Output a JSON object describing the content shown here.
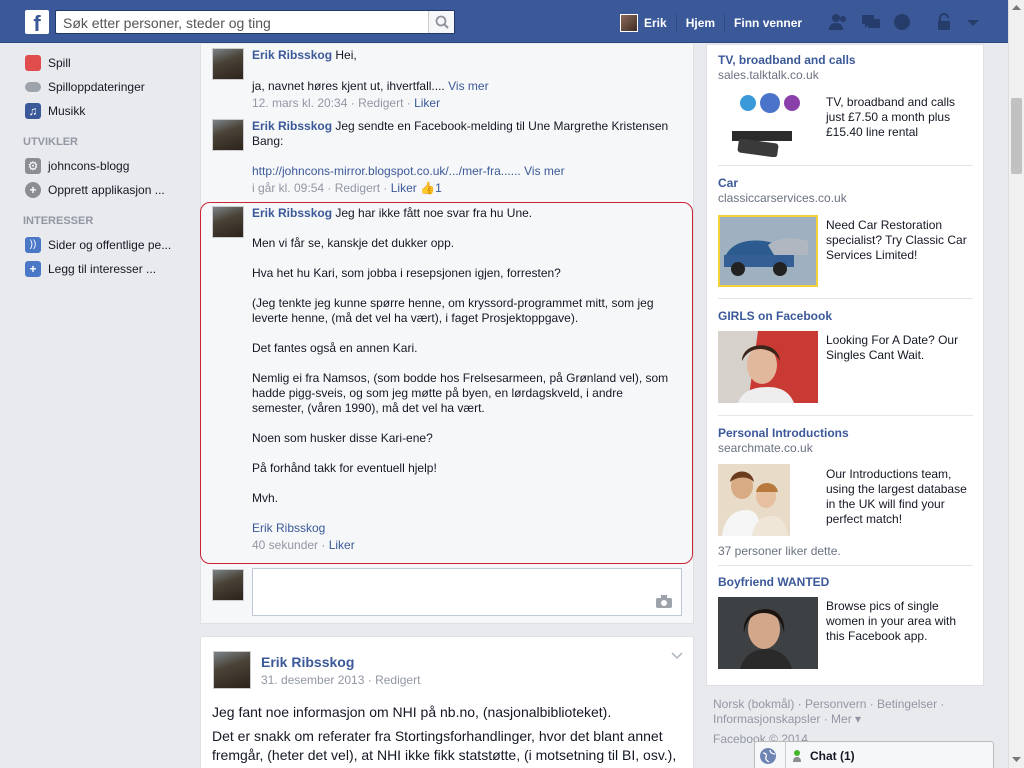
{
  "topbar": {
    "logo": "f",
    "search_placeholder": "Søk etter personer, steder og ting",
    "nav_user": "Erik",
    "nav_home": "Hjem",
    "nav_friends": "Finn venner"
  },
  "sidebar": {
    "items_top": [
      {
        "label": "Spill",
        "icon": "games-icon",
        "color": "#e14d4d"
      },
      {
        "label": "Spilloppdateringer",
        "icon": "game-controller-icon",
        "color": "#8a8d91"
      },
      {
        "label": "Musikk",
        "icon": "music-icon",
        "color": "#3b5998"
      }
    ],
    "dev_header": "UTVIKLER",
    "items_dev": [
      {
        "label": "johncons-blogg",
        "icon": "gear-icon",
        "color": "#8a8d91"
      },
      {
        "label": "Opprett applikasjon ...",
        "icon": "plus-circle-icon",
        "color": "#8a8d91"
      }
    ],
    "interest_header": "INTERESSER",
    "items_interest": [
      {
        "label": "Sider og offentlige pe...",
        "icon": "rss-icon",
        "color": "#4a78c7"
      },
      {
        "label": "Legg til interesser ...",
        "icon": "plus-icon",
        "color": "#4a78c7"
      }
    ]
  },
  "comments": [
    {
      "author": "Erik Ribsskog",
      "first": "Hei,",
      "second": "ja, navnet høres kjent ut, ihvertfall....",
      "see_more": "Vis mer",
      "time": "12. mars kl. 20:34",
      "edited": "Redigert",
      "like": "Liker"
    },
    {
      "author": "Erik Ribsskog",
      "first": "Jeg sendte en Facebook-melding til Une Margrethe Kristensen Bang:",
      "link": "http://johncons-mirror.blogspot.co.uk/.../mer-fra......",
      "see_more": "Vis mer",
      "time": "i går kl. 09:54",
      "edited": "Redigert",
      "like": "Liker",
      "like_count": "1"
    },
    {
      "author": "Erik Ribsskog",
      "first": "Jeg har ikke fått noe svar fra hu Une.",
      "paragraphs": [
        "Men vi får se, kanskje det dukker opp.",
        "Hva het hu Kari, som jobba i resepsjonen igjen, forresten?",
        "(Jeg tenkte jeg kunne spørre henne, om kryssord-programmet mitt, som jeg leverte henne, (må det vel ha vært), i faget Prosjektoppgave).",
        "Det fantes også en annen Kari.",
        "Nemlig ei fra Namsos, (som bodde hos Frelsesarmeen, på Grønland vel), som hadde pigg-sveis, og som jeg møtte på byen, en lørdagskveld, i andre semester, (våren 1990), må det vel ha vært.",
        "Noen som husker disse Kari-ene?",
        "På forhånd takk for eventuell hjelp!",
        "Mvh."
      ],
      "signature": "Erik Ribsskog",
      "time": "40 sekunder",
      "like": "Liker"
    }
  ],
  "post": {
    "author": "Erik Ribsskog",
    "date": "31. desember 2013",
    "edited": "Redigert",
    "line1": "Jeg fant noe informasjon om NHI på nb.no, (nasjonalbiblioteket).",
    "line2": "Det er snakk om referater fra Stortingsforhandlinger, hvor det blant annet fremgår, (heter det vel), at NHI ikke fikk statstøtte, (i motsetning til BI, osv.),"
  },
  "ads": [
    {
      "title": "TV, broadband and calls",
      "url": "sales.talktalk.co.uk",
      "text": "TV, broadband and calls just £7.50 a month plus £15.40 line rental"
    },
    {
      "title": "Car",
      "url": "classiccarservices.co.uk",
      "text": "Need Car Restoration specialist? Try Classic Car Services Limited!"
    },
    {
      "title": "GIRLS on Facebook",
      "url": "",
      "text": "Looking For A Date? Our Singles Cant Wait."
    },
    {
      "title": "Personal Introductions",
      "url": "searchmate.co.uk",
      "text": "Our Introductions team, using the largest database in the UK will find your perfect match!",
      "likes": "37 personer liker dette."
    },
    {
      "title": "Boyfriend WANTED",
      "url": "",
      "text": "Browse pics of single women in your area with this Facebook app."
    }
  ],
  "footer": {
    "l1": "Norsk (bokmål) · Personvern · Betingelser ·",
    "l2": "Informasjonskapsler · Mer ▾",
    "l3": "Facebook © 2014"
  },
  "chat": {
    "label": "Chat (1)"
  }
}
